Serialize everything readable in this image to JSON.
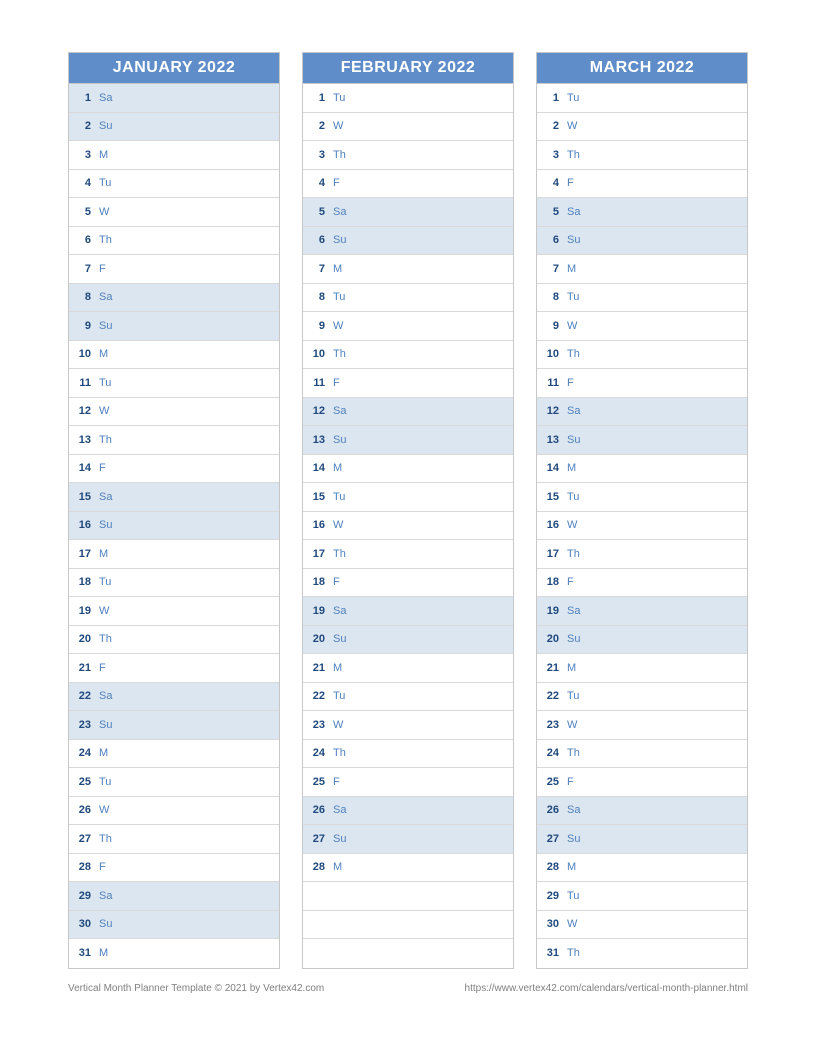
{
  "months": [
    {
      "title": "JANUARY 2022",
      "days": [
        {
          "num": "1",
          "name": "Sa",
          "weekend": true
        },
        {
          "num": "2",
          "name": "Su",
          "weekend": true
        },
        {
          "num": "3",
          "name": "M",
          "weekend": false
        },
        {
          "num": "4",
          "name": "Tu",
          "weekend": false
        },
        {
          "num": "5",
          "name": "W",
          "weekend": false
        },
        {
          "num": "6",
          "name": "Th",
          "weekend": false
        },
        {
          "num": "7",
          "name": "F",
          "weekend": false
        },
        {
          "num": "8",
          "name": "Sa",
          "weekend": true
        },
        {
          "num": "9",
          "name": "Su",
          "weekend": true
        },
        {
          "num": "10",
          "name": "M",
          "weekend": false
        },
        {
          "num": "11",
          "name": "Tu",
          "weekend": false
        },
        {
          "num": "12",
          "name": "W",
          "weekend": false
        },
        {
          "num": "13",
          "name": "Th",
          "weekend": false
        },
        {
          "num": "14",
          "name": "F",
          "weekend": false
        },
        {
          "num": "15",
          "name": "Sa",
          "weekend": true
        },
        {
          "num": "16",
          "name": "Su",
          "weekend": true
        },
        {
          "num": "17",
          "name": "M",
          "weekend": false
        },
        {
          "num": "18",
          "name": "Tu",
          "weekend": false
        },
        {
          "num": "19",
          "name": "W",
          "weekend": false
        },
        {
          "num": "20",
          "name": "Th",
          "weekend": false
        },
        {
          "num": "21",
          "name": "F",
          "weekend": false
        },
        {
          "num": "22",
          "name": "Sa",
          "weekend": true
        },
        {
          "num": "23",
          "name": "Su",
          "weekend": true
        },
        {
          "num": "24",
          "name": "M",
          "weekend": false
        },
        {
          "num": "25",
          "name": "Tu",
          "weekend": false
        },
        {
          "num": "26",
          "name": "W",
          "weekend": false
        },
        {
          "num": "27",
          "name": "Th",
          "weekend": false
        },
        {
          "num": "28",
          "name": "F",
          "weekend": false
        },
        {
          "num": "29",
          "name": "Sa",
          "weekend": true
        },
        {
          "num": "30",
          "name": "Su",
          "weekend": true
        },
        {
          "num": "31",
          "name": "M",
          "weekend": false
        }
      ]
    },
    {
      "title": "FEBRUARY 2022",
      "days": [
        {
          "num": "1",
          "name": "Tu",
          "weekend": false
        },
        {
          "num": "2",
          "name": "W",
          "weekend": false
        },
        {
          "num": "3",
          "name": "Th",
          "weekend": false
        },
        {
          "num": "4",
          "name": "F",
          "weekend": false
        },
        {
          "num": "5",
          "name": "Sa",
          "weekend": true
        },
        {
          "num": "6",
          "name": "Su",
          "weekend": true
        },
        {
          "num": "7",
          "name": "M",
          "weekend": false
        },
        {
          "num": "8",
          "name": "Tu",
          "weekend": false
        },
        {
          "num": "9",
          "name": "W",
          "weekend": false
        },
        {
          "num": "10",
          "name": "Th",
          "weekend": false
        },
        {
          "num": "11",
          "name": "F",
          "weekend": false
        },
        {
          "num": "12",
          "name": "Sa",
          "weekend": true
        },
        {
          "num": "13",
          "name": "Su",
          "weekend": true
        },
        {
          "num": "14",
          "name": "M",
          "weekend": false
        },
        {
          "num": "15",
          "name": "Tu",
          "weekend": false
        },
        {
          "num": "16",
          "name": "W",
          "weekend": false
        },
        {
          "num": "17",
          "name": "Th",
          "weekend": false
        },
        {
          "num": "18",
          "name": "F",
          "weekend": false
        },
        {
          "num": "19",
          "name": "Sa",
          "weekend": true
        },
        {
          "num": "20",
          "name": "Su",
          "weekend": true
        },
        {
          "num": "21",
          "name": "M",
          "weekend": false
        },
        {
          "num": "22",
          "name": "Tu",
          "weekend": false
        },
        {
          "num": "23",
          "name": "W",
          "weekend": false
        },
        {
          "num": "24",
          "name": "Th",
          "weekend": false
        },
        {
          "num": "25",
          "name": "F",
          "weekend": false
        },
        {
          "num": "26",
          "name": "Sa",
          "weekend": true
        },
        {
          "num": "27",
          "name": "Su",
          "weekend": true
        },
        {
          "num": "28",
          "name": "M",
          "weekend": false
        },
        {
          "num": "",
          "name": "",
          "weekend": false,
          "empty": true
        },
        {
          "num": "",
          "name": "",
          "weekend": false,
          "empty": true
        },
        {
          "num": "",
          "name": "",
          "weekend": false,
          "empty": true
        }
      ]
    },
    {
      "title": "MARCH 2022",
      "days": [
        {
          "num": "1",
          "name": "Tu",
          "weekend": false
        },
        {
          "num": "2",
          "name": "W",
          "weekend": false
        },
        {
          "num": "3",
          "name": "Th",
          "weekend": false
        },
        {
          "num": "4",
          "name": "F",
          "weekend": false
        },
        {
          "num": "5",
          "name": "Sa",
          "weekend": true
        },
        {
          "num": "6",
          "name": "Su",
          "weekend": true
        },
        {
          "num": "7",
          "name": "M",
          "weekend": false
        },
        {
          "num": "8",
          "name": "Tu",
          "weekend": false
        },
        {
          "num": "9",
          "name": "W",
          "weekend": false
        },
        {
          "num": "10",
          "name": "Th",
          "weekend": false
        },
        {
          "num": "11",
          "name": "F",
          "weekend": false
        },
        {
          "num": "12",
          "name": "Sa",
          "weekend": true
        },
        {
          "num": "13",
          "name": "Su",
          "weekend": true
        },
        {
          "num": "14",
          "name": "M",
          "weekend": false
        },
        {
          "num": "15",
          "name": "Tu",
          "weekend": false
        },
        {
          "num": "16",
          "name": "W",
          "weekend": false
        },
        {
          "num": "17",
          "name": "Th",
          "weekend": false
        },
        {
          "num": "18",
          "name": "F",
          "weekend": false
        },
        {
          "num": "19",
          "name": "Sa",
          "weekend": true
        },
        {
          "num": "20",
          "name": "Su",
          "weekend": true
        },
        {
          "num": "21",
          "name": "M",
          "weekend": false
        },
        {
          "num": "22",
          "name": "Tu",
          "weekend": false
        },
        {
          "num": "23",
          "name": "W",
          "weekend": false
        },
        {
          "num": "24",
          "name": "Th",
          "weekend": false
        },
        {
          "num": "25",
          "name": "F",
          "weekend": false
        },
        {
          "num": "26",
          "name": "Sa",
          "weekend": true
        },
        {
          "num": "27",
          "name": "Su",
          "weekend": true
        },
        {
          "num": "28",
          "name": "M",
          "weekend": false
        },
        {
          "num": "29",
          "name": "Tu",
          "weekend": false
        },
        {
          "num": "30",
          "name": "W",
          "weekend": false
        },
        {
          "num": "31",
          "name": "Th",
          "weekend": false
        }
      ]
    }
  ],
  "footer": {
    "left": "Vertical Month Planner Template © 2021 by Vertex42.com",
    "right": "https://www.vertex42.com/calendars/vertical-month-planner.html"
  }
}
